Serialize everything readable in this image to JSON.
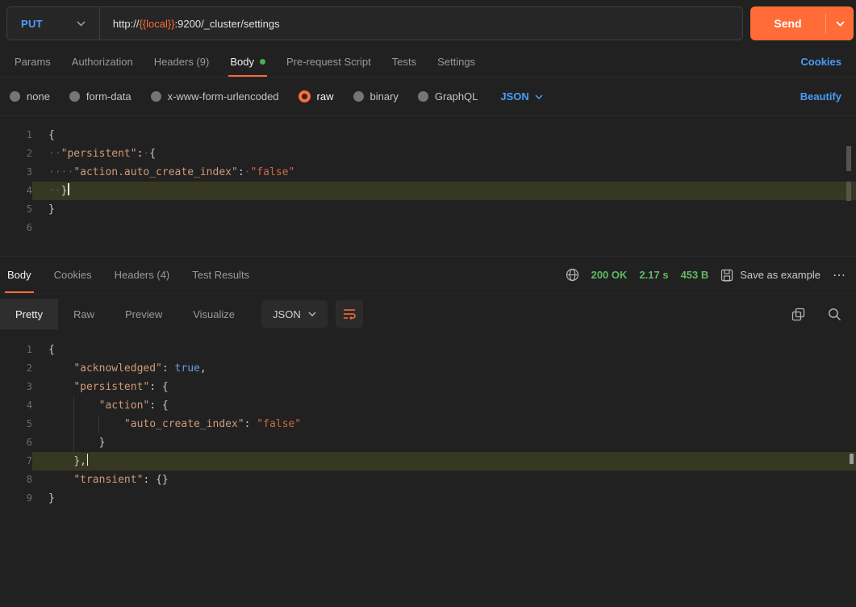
{
  "colors": {
    "accent": "#ff6c37",
    "link": "#4a9cf8",
    "green": "#5fba65",
    "method": "#4f9cf8",
    "tok_k": "#cf9a78",
    "tok_s": "#cd6848",
    "tok_b": "#6f9be8",
    "tok_p": "#c9c9c9",
    "tok_w": "#5c5c5c",
    "dot_green": "#4caf50"
  },
  "request": {
    "method": "PUT",
    "url_prefix": "http://",
    "url_variable": "{{local}}",
    "url_suffix": ":9200/_cluster/settings",
    "send_label": "Send"
  },
  "request_tabs": {
    "items": [
      {
        "label": "Params"
      },
      {
        "label": "Authorization"
      },
      {
        "label": "Headers (9)"
      },
      {
        "label": "Body",
        "active": true
      },
      {
        "label": "Pre-request Script"
      },
      {
        "label": "Tests"
      },
      {
        "label": "Settings"
      }
    ],
    "cookies_label": "Cookies"
  },
  "body_type_bar": {
    "options": [
      {
        "label": "none"
      },
      {
        "label": "form-data"
      },
      {
        "label": "x-www-form-urlencoded"
      },
      {
        "label": "raw",
        "selected": true
      },
      {
        "label": "binary"
      },
      {
        "label": "GraphQL"
      }
    ],
    "language": "JSON",
    "beautify_label": "Beautify"
  },
  "request_editor": {
    "lines": [
      {
        "n": 1,
        "tokens": [
          [
            "p",
            "{"
          ]
        ]
      },
      {
        "n": 2,
        "tokens": [
          [
            "w",
            "··"
          ],
          [
            "k",
            "\"persistent\""
          ],
          [
            "p",
            ":"
          ],
          [
            "w",
            "·"
          ],
          [
            "p",
            "{"
          ]
        ]
      },
      {
        "n": 3,
        "tokens": [
          [
            "w",
            "····"
          ],
          [
            "k",
            "\"action.auto_create_index\""
          ],
          [
            "p",
            ":"
          ],
          [
            "w",
            "·"
          ],
          [
            "s",
            "\"false\""
          ]
        ]
      },
      {
        "n": 4,
        "tokens": [
          [
            "w",
            "··"
          ],
          [
            "p",
            "}"
          ]
        ],
        "highlight": true,
        "caret": true
      },
      {
        "n": 5,
        "tokens": [
          [
            "p",
            "}"
          ]
        ]
      },
      {
        "n": 6,
        "tokens": []
      }
    ]
  },
  "response_header": {
    "tabs": [
      {
        "label": "Body",
        "active": true
      },
      {
        "label": "Cookies"
      },
      {
        "label": "Headers (4)"
      },
      {
        "label": "Test Results"
      }
    ],
    "status": "200 OK",
    "time": "2.17 s",
    "size": "453 B",
    "save_label": "Save as example",
    "more_label": "⋯"
  },
  "response_toolbar": {
    "views": [
      {
        "label": "Pretty",
        "active": true
      },
      {
        "label": "Raw"
      },
      {
        "label": "Preview"
      },
      {
        "label": "Visualize"
      }
    ],
    "language": "JSON"
  },
  "response_editor": {
    "lines": [
      {
        "n": 1,
        "tokens": [
          [
            "p",
            "{"
          ]
        ]
      },
      {
        "n": 2,
        "tokens": [
          [
            "t",
            "    "
          ],
          [
            "k",
            "\"acknowledged\""
          ],
          [
            "p",
            ":"
          ],
          [
            "t",
            " "
          ],
          [
            "b",
            "true"
          ],
          [
            "p",
            ","
          ]
        ]
      },
      {
        "n": 3,
        "tokens": [
          [
            "t",
            "    "
          ],
          [
            "k",
            "\"persistent\""
          ],
          [
            "p",
            ":"
          ],
          [
            "t",
            " "
          ],
          [
            "p",
            "{"
          ]
        ]
      },
      {
        "n": 4,
        "tokens": [
          [
            "t",
            "        "
          ],
          [
            "k",
            "\"action\""
          ],
          [
            "p",
            ":"
          ],
          [
            "t",
            " "
          ],
          [
            "p",
            "{"
          ]
        ]
      },
      {
        "n": 5,
        "tokens": [
          [
            "t",
            "            "
          ],
          [
            "k",
            "\"auto_create_index\""
          ],
          [
            "p",
            ":"
          ],
          [
            "t",
            " "
          ],
          [
            "s",
            "\"false\""
          ]
        ]
      },
      {
        "n": 6,
        "tokens": [
          [
            "t",
            "        "
          ],
          [
            "p",
            "}"
          ]
        ]
      },
      {
        "n": 7,
        "tokens": [
          [
            "t",
            "    "
          ],
          [
            "p",
            "},"
          ]
        ],
        "highlight": true,
        "caret": true
      },
      {
        "n": 8,
        "tokens": [
          [
            "t",
            "    "
          ],
          [
            "k",
            "\"transient\""
          ],
          [
            "p",
            ":"
          ],
          [
            "t",
            " "
          ],
          [
            "p",
            "{}"
          ]
        ]
      },
      {
        "n": 9,
        "tokens": [
          [
            "p",
            "}"
          ]
        ]
      }
    ]
  }
}
